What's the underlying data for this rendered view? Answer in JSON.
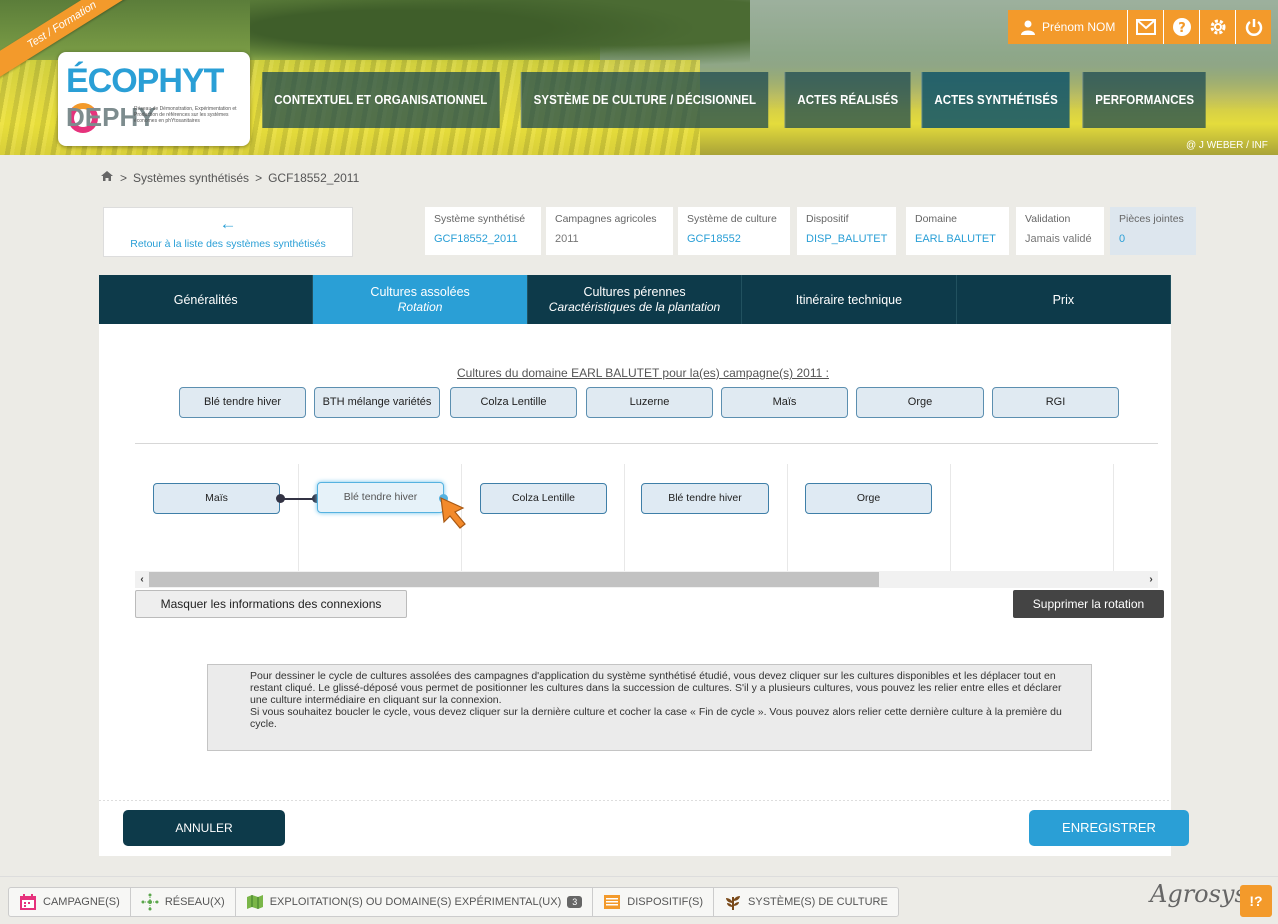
{
  "header": {
    "ribbon": "Test / Formation",
    "logo_top": "ÉCOPHYT",
    "logo_bottom": "DEPHY",
    "logo_small": "Réseau de Démonstration, Expérimentation et Production de références sur les systèmes économes en phYtosanitaires",
    "nav": [
      "CONTEXTUEL ET ORGANISATIONNEL",
      "SYSTÈME DE CULTURE / DÉCISIONNEL",
      "ACTES RÉALISÉS",
      "ACTES SYNTHÉTISÉS",
      "PERFORMANCES"
    ],
    "user": "Prénom NOM",
    "credit": "@ J WEBER / INF",
    "colors": {
      "accent": "#f39a2b",
      "blue": "#2a9fd6",
      "dark": "#0d3a4a"
    }
  },
  "breadcrumb": {
    "sep1": ">",
    "item1": "Systèmes synthétisés",
    "sep2": ">",
    "item2": "GCF18552_2011"
  },
  "summary": {
    "back_label": "Retour à la liste des systèmes synthétisés",
    "fields": [
      {
        "label": "Système synthétisé",
        "value": "GCF18552_2011"
      },
      {
        "label": "Campagnes agricoles",
        "value": "2011"
      },
      {
        "label": "Système de culture",
        "value": "GCF18552"
      },
      {
        "label": "Dispositif",
        "value": "DISP_BALUTET"
      },
      {
        "label": "Domaine",
        "value": "EARL BALUTET"
      },
      {
        "label": "Validation",
        "value": "Jamais validé"
      },
      {
        "label": "Pièces jointes",
        "value": "0"
      }
    ]
  },
  "tabs": [
    {
      "label": "Généralités",
      "sub": ""
    },
    {
      "label": "Cultures assolées",
      "sub": "Rotation"
    },
    {
      "label": "Cultures pérennes",
      "sub": "Caractéristiques de la plantation"
    },
    {
      "label": "Itinéraire technique",
      "sub": ""
    },
    {
      "label": "Prix",
      "sub": ""
    }
  ],
  "crops": {
    "title": "Cultures du domaine EARL BALUTET pour la(es) campagne(s) 2011 :",
    "items": [
      "Blé tendre hiver",
      "BTH mélange variétés",
      "Colza Lentille",
      "Luzerne",
      "Maïs",
      "Orge",
      "RGI"
    ]
  },
  "rotation": {
    "nodes": [
      "Maïs",
      "Blé tendre hiver",
      "Colza Lentille",
      "Blé tendre hiver",
      "Orge"
    ]
  },
  "buttons": {
    "hide_connections": "Masquer les informations des connexions",
    "delete_rotation": "Supprimer la rotation",
    "cancel": "ANNULER",
    "save": "ENREGISTRER"
  },
  "help": {
    "p1": "Pour dessiner le cycle de cultures assolées des campagnes d'application du système synthétisé étudié, vous devez cliquer sur les cultures disponibles et les déplacer tout en restant cliqué. Le glissé-déposé vous permet de positionner les cultures dans la succession de cultures. S'il y a plusieurs cultures, vous pouvez les relier entre elles et déclarer une culture intermédiaire en cliquant sur la connexion.",
    "p2": "Si vous souhaitez boucler le cycle, vous devez cliquer sur la dernière culture et cocher la case « Fin de cycle ». Vous pouvez alors relier cette dernière culture à la première du cycle."
  },
  "bottombar": {
    "items": [
      "CAMPAGNE(S)",
      "RÉSEAU(X)",
      "EXPLOITATION(S) OU DOMAINE(S) EXPÉRIMENTAL(UX)",
      "DISPOSITIF(S)",
      "SYSTÈME(S) DE CULTURE"
    ],
    "badge": "3",
    "brand": "Agrosyst",
    "help": "!?"
  }
}
